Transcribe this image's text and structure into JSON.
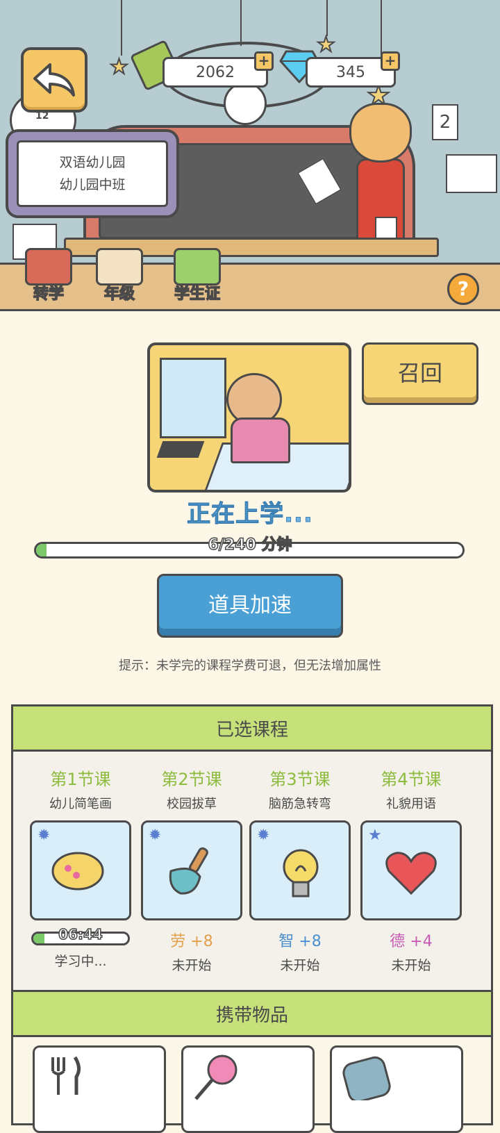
{
  "header": {
    "cash": "2062",
    "gems": "345",
    "plus_label": "+",
    "clock_number": "12",
    "paper_number": "2",
    "school_name": "双语幼儿园",
    "class_name": "幼儿园中班"
  },
  "toolbar": {
    "items": [
      {
        "label": "转学",
        "icon": "school-building-icon"
      },
      {
        "label": "年级",
        "icon": "grade-icon"
      },
      {
        "label": "学生证",
        "icon": "student-id-icon"
      }
    ],
    "help_label": "?"
  },
  "study": {
    "recall_label": "召回",
    "status_text": "正在上学...",
    "progress_text": "6/240 分钟",
    "progress_fraction": 0.025,
    "speed_label": "道具加速",
    "hint": "提示：未学完的课程学费可退，但无法增加属性"
  },
  "courses": {
    "title": "已选课程",
    "items": [
      {
        "num": "第1节课",
        "name": "幼儿简笔画",
        "icon": "palette-icon",
        "badge": "gear-icon",
        "time": "06:44",
        "progress_fraction": 0.12,
        "status": "学习中..."
      },
      {
        "num": "第2节课",
        "name": "校园拔草",
        "icon": "shovel-icon",
        "badge": "gear-icon",
        "gain_attr": "劳",
        "gain_value": "+8",
        "gain_color": "#e3a04a",
        "status": "未开始"
      },
      {
        "num": "第3节课",
        "name": "脑筋急转弯",
        "icon": "lightbulb-icon",
        "badge": "gear-icon",
        "gain_attr": "智",
        "gain_value": "+8",
        "gain_color": "#4a8fd0",
        "status": "未开始"
      },
      {
        "num": "第4节课",
        "name": "礼貌用语",
        "icon": "heart-icon",
        "badge": "star-icon",
        "gain_attr": "德",
        "gain_value": "+4",
        "gain_color": "#c85ab5",
        "status": "未开始"
      }
    ]
  },
  "carry": {
    "title": "携带物品",
    "items": [
      {
        "icon": "fork-knife-icon"
      },
      {
        "icon": "lollipop-icon"
      },
      {
        "icon": "backpack-icon"
      }
    ]
  }
}
